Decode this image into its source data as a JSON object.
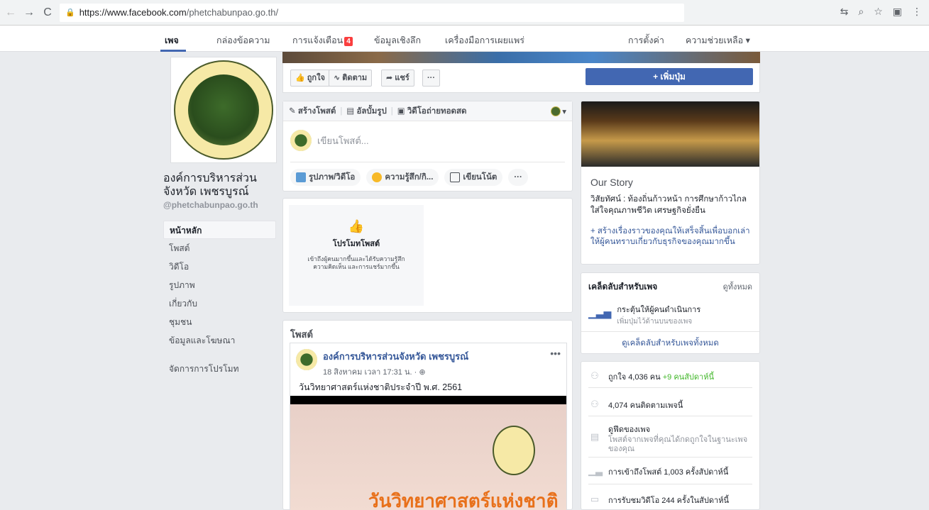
{
  "browser": {
    "url_main": "https://www.facebook.com",
    "url_path": "/phetchabunpao.go.th/"
  },
  "topnav": {
    "page": "เพจ",
    "inbox": "กล่องข้อความ",
    "notifications": "การแจ้งเตือน",
    "notifications_count": "4",
    "insights": "ข้อมูลเชิงลึก",
    "publishing_tools": "เครื่องมือการเผยแพร่",
    "settings": "การตั้งค่า",
    "help": "ความช่วยเหลือ ▾"
  },
  "left": {
    "page_name": "องค์การบริหารส่วนจังหวัด เพชรบูรณ์",
    "handle": "@phetchabunpao.go.th",
    "menu": [
      "หน้าหลัก",
      "โพสต์",
      "วิดีโอ",
      "รูปภาพ",
      "เกี่ยวกับ",
      "ชุมชน",
      "ข้อมูลและโฆษณา"
    ],
    "manage_promotions": "จัดการการโปรโมท"
  },
  "actions": {
    "like": "ถูกใจ",
    "follow": "ติดตาม",
    "share": "แชร์",
    "more": "···",
    "add_button": "+ เพิ่มปุ่ม"
  },
  "composer": {
    "tab_create": "สร้างโพสต์",
    "tab_album": "อัลบั้มรูป",
    "tab_live": "วิดีโอถ่ายทอดสด",
    "placeholder": "เขียนโพสต์...",
    "opt_photo": "รูปภาพ/วิดีโอ",
    "opt_feeling": "ความรู้สึก/กิ...",
    "opt_note": "เขียนโน้ต",
    "opt_more": "···"
  },
  "promo": {
    "title": "โปรโมทโพสต์",
    "desc": "เข้าถึงผู้คนมากขึ้นและได้รับความรู้สึก ความคิดเห็น และการแชร์มากขึ้น"
  },
  "posts": {
    "heading": "โพสต์",
    "author": "องค์การบริหารส่วนจังหวัด เพชรบูรณ์",
    "time": "18 สิงหาคม เวลา 17:31 น. · ⊕",
    "text": "วันวิทยาศาสตร์แห่งชาติประจำปี พ.ศ. 2561",
    "image_text": "วันวิทยาศาสตร์แห่งชาติ"
  },
  "story": {
    "title": "Our Story",
    "text": "วิสัยทัศน์ : ท้องถิ่นก้าวหน้า การศึกษาก้าวไกล ใส่ใจคุณภาพชีวิต เศรษฐกิจยั่งยืน",
    "link": "+ สร้างเรื่องราวของคุณให้เสร็จสิ้นเพื่อบอกเล่าให้ผู้คนทราบเกี่ยวกับธุรกิจของคุณมากขึ้น"
  },
  "tips": {
    "heading": "เคล็ดลับสำหรับเพจ",
    "see_all": "ดูทั้งหมด",
    "tip_title": "กระตุ้นให้ผู้คนดำเนินการ",
    "tip_sub": "เพิ่มปุ่มไว้ด้านบนของเพจ",
    "footer": "ดูเคล็ดลับสำหรับเพจทั้งหมด"
  },
  "stats": {
    "likes": "ถูกใจ 4,036 คน",
    "likes_delta": "+9 คนสัปดาห์นี้",
    "follows": "4,074 คนติดตามเพจนี้",
    "feed_title": "ดูฟีดของเพจ",
    "feed_sub": "โพสต์จากเพจที่คุณได้กดถูกใจในฐานะเพจของคุณ",
    "reach": "การเข้าถึงโพสต์ 1,003 ครั้งสัปดาห์นี้",
    "video": "การรับชมวิดีโอ 244 ครั้งในสัปดาห์นี้"
  },
  "colors": {
    "brand": "#4267b2",
    "link": "#365899",
    "badge": "#fa3e3e",
    "positive": "#42b72a"
  }
}
